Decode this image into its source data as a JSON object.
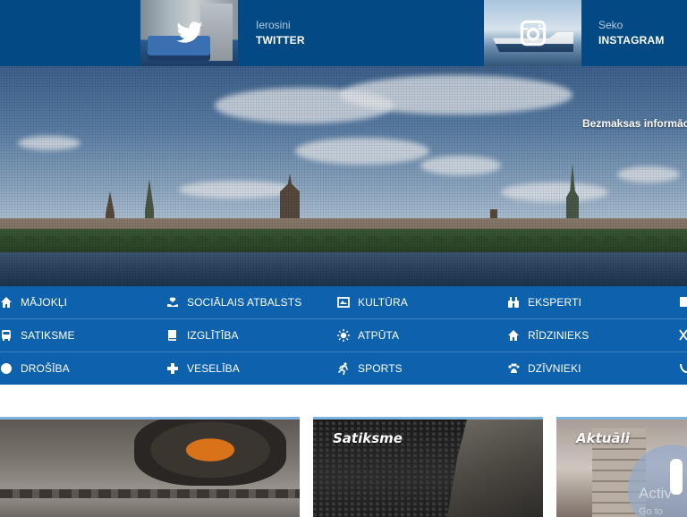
{
  "social": {
    "twitter": {
      "label_small": "Ierosini",
      "label_big": "TWITTER",
      "icon": "twitter-bird-icon"
    },
    "instagram": {
      "label_small": "Seko",
      "label_big": "INSTAGRAM",
      "icon": "instagram-camera-icon"
    }
  },
  "hero": {
    "tagline": "Bezmaksas informāci"
  },
  "categories": [
    {
      "label": "MĀJOKĻI",
      "icon": "home-icon"
    },
    {
      "label": "SOCIĀLAIS ATBALSTS",
      "icon": "hand-heart-icon"
    },
    {
      "label": "KULTŪRA",
      "icon": "theater-icon"
    },
    {
      "label": "EKSPERTI",
      "icon": "binoculars-icon"
    },
    {
      "label": "SATIKSME",
      "icon": "bus-icon"
    },
    {
      "label": "IZGLĪTĪBA",
      "icon": "book-icon"
    },
    {
      "label": "ATPŪTA",
      "icon": "sun-icon"
    },
    {
      "label": "RĪDZINIEKS",
      "icon": "house-icon"
    },
    {
      "label": "DROŠĪBA",
      "icon": "shield-icon"
    },
    {
      "label": "VESELĪBA",
      "icon": "cross-icon"
    },
    {
      "label": "SPORTS",
      "icon": "runner-icon"
    },
    {
      "label": "DZĪVNIEKI",
      "icon": "paw-icon"
    }
  ],
  "cards": [
    {
      "title": ""
    },
    {
      "title": "Satiksme"
    },
    {
      "title": "Aktuāli"
    }
  ],
  "watermark": {
    "line1": "Activ",
    "line2": "Go to"
  },
  "colors": {
    "topbar": "#034a84",
    "nav": "#0d61ad",
    "card_border": "#7fb3df"
  }
}
